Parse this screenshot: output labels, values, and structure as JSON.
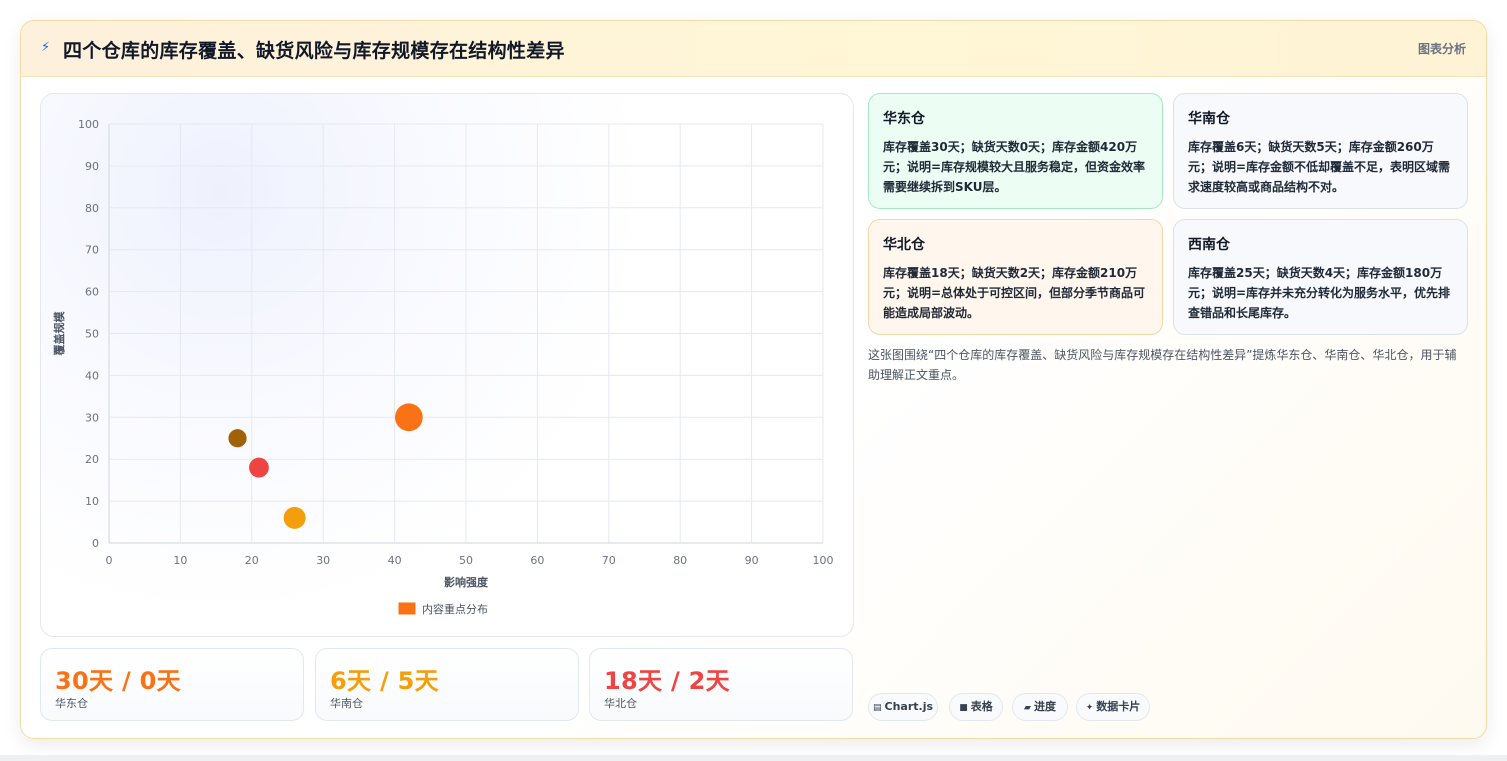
{
  "header": {
    "icon": "lightning-icon",
    "title": "四个仓库的库存覆盖、缺货风险与库存规模存在结构性差异",
    "tag": "图表分析"
  },
  "chart_data": {
    "type": "scatter",
    "xlabel": "影响强度",
    "ylabel": "覆盖规模",
    "xlim": [
      0,
      100
    ],
    "ylim": [
      0,
      100
    ],
    "x_ticks": [
      "0",
      "10",
      "20",
      "30",
      "40",
      "50",
      "60",
      "70",
      "80",
      "90",
      "100"
    ],
    "y_ticks": [
      "100",
      "90",
      "80",
      "70",
      "60",
      "50",
      "40",
      "30",
      "20",
      "10",
      "0"
    ],
    "grid": true,
    "legend_position": "bottom",
    "series": [
      {
        "name": "内容重点分布",
        "points": [
          {
            "x": 42,
            "y": 30,
            "size": 420,
            "color": "#f97316"
          },
          {
            "x": 26,
            "y": 6,
            "size": 260,
            "color": "#f59e0b"
          },
          {
            "x": 21,
            "y": 18,
            "size": 210,
            "color": "#ef4444"
          },
          {
            "x": 18,
            "y": 25,
            "size": 180,
            "color": "#a16207"
          }
        ]
      }
    ],
    "legend_color": "#f97316"
  },
  "stats": [
    {
      "value": "30天 / 0天",
      "label": "华东仓",
      "color": "#f97316"
    },
    {
      "value": "6天 / 5天",
      "label": "华南仓",
      "color": "#f59e0b"
    },
    {
      "value": "18天 / 2天",
      "label": "华北仓",
      "color": "#ef4444"
    }
  ],
  "cards": [
    {
      "title": "华东仓",
      "text": "库存覆盖30天；缺货天数0天；库存金额420万元；说明=库存规模较大且服务稳定，但资金效率需要继续拆到SKU层。",
      "bg": "#ecfdf3",
      "border": "#a7e8c4"
    },
    {
      "title": "华南仓",
      "text": "库存覆盖6天；缺货天数5天；库存金额260万元；说明=库存金额不低却覆盖不足，表明区域需求速度较高或商品结构不对。",
      "bg": "#f7f9fc",
      "border": "#dbe3ea"
    },
    {
      "title": "华北仓",
      "text": "库存覆盖18天；缺货天数2天；库存金额210万元；说明=总体处于可控区间，但部分季节商品可能造成局部波动。",
      "bg": "#fff7ed",
      "border": "#f5d7a6"
    },
    {
      "title": "西南仓",
      "text": "库存覆盖25天；缺货天数4天；库存金额180万元；说明=库存并未充分转化为服务水平，优先排查错品和长尾库存。",
      "bg": "#f7f9fc",
      "border": "#dbe3ea"
    }
  ],
  "note": "这张图围绕“四个仓库的库存覆盖、缺货风险与库存规模存在结构性差异”提炼华东仓、华南仓、华北仓，用于辅助理解正文重点。",
  "chips": [
    {
      "icon": "chart-icon",
      "glyph": "▤",
      "label": "Chart.js"
    },
    {
      "icon": "table-icon",
      "glyph": "■",
      "label": "表格"
    },
    {
      "icon": "progress-icon",
      "glyph": "▰",
      "label": "进度"
    },
    {
      "icon": "sparkle-icon",
      "glyph": "✦",
      "label": "数据卡片"
    }
  ]
}
